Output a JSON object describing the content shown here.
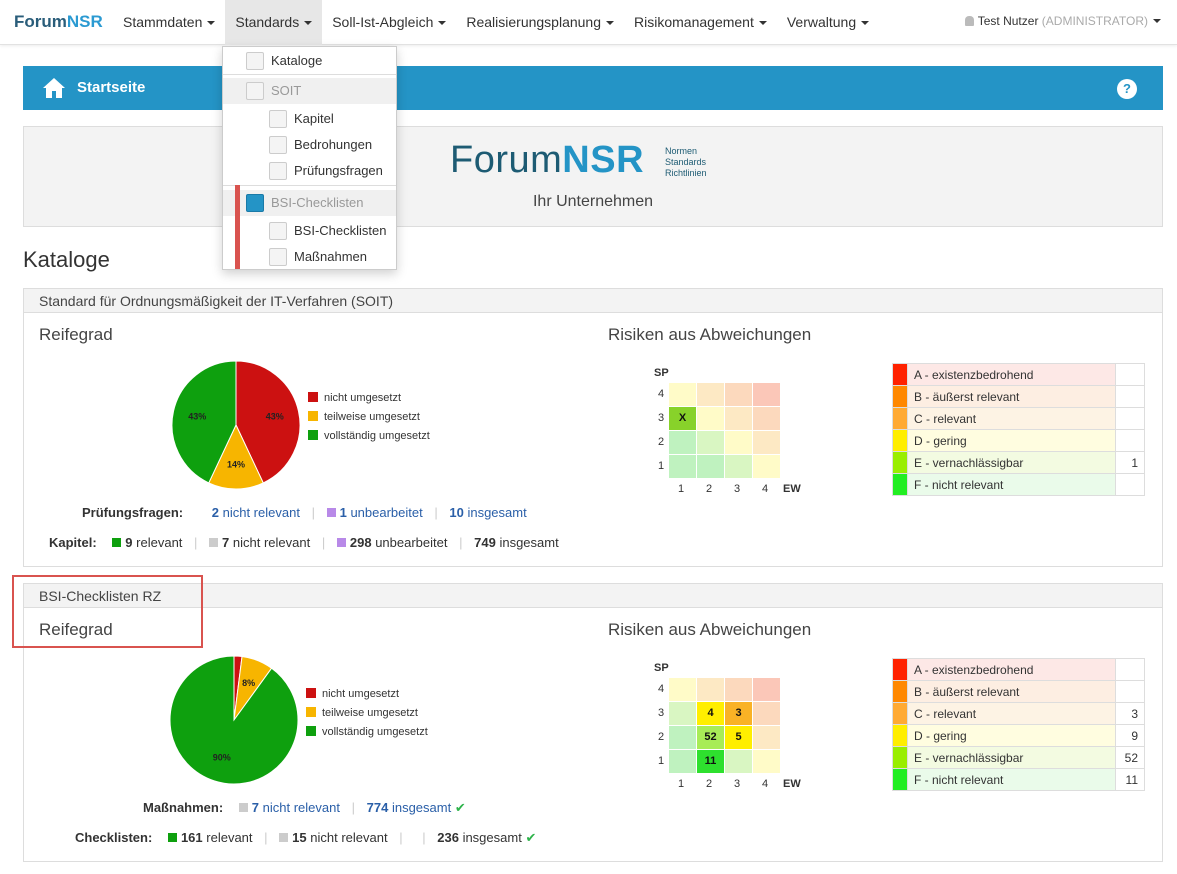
{
  "brand": {
    "part1": "Forum",
    "part2": "NSR"
  },
  "nav": {
    "items": [
      {
        "label": "Stammdaten",
        "active": false
      },
      {
        "label": "Standards",
        "active": true
      },
      {
        "label": "Soll-Ist-Abgleich",
        "active": false
      },
      {
        "label": "Realisierungsplanung",
        "active": false
      },
      {
        "label": "Risikomanagement",
        "active": false
      },
      {
        "label": "Verwaltung",
        "active": false
      }
    ],
    "user": {
      "name": "Test Nutzer",
      "role": "(ADMINISTRATOR)"
    }
  },
  "dropdown": {
    "kataloge": "Kataloge",
    "soit": "SOIT",
    "kapitel": "Kapitel",
    "bedrohungen": "Bedrohungen",
    "pruefungsfragen": "Prüfungsfragen",
    "bsi_head": "BSI-Checklisten",
    "bsi_checklisten": "BSI-Checklisten",
    "massnahmen": "Maßnahmen"
  },
  "bluebar": {
    "title": "Startseite",
    "help": "?"
  },
  "banner": {
    "logo1": "Forum",
    "logo2": "NSR",
    "tag1": "Normen",
    "tag2": "Standards",
    "tag3": "Richtlinien",
    "company": "Ihr Unternehmen"
  },
  "heading": "Kataloge",
  "colors": {
    "red": "#cc1111",
    "orange": "#f7b500",
    "green": "#0ea00e",
    "gray": "#cccccc",
    "purple": "#b889e8"
  },
  "panel1": {
    "title": "Standard für Ordnungsmäßigkeit der IT-Verfahren (SOIT)",
    "reifegrad": "Reifegrad",
    "risiken": "Risiken aus Abweichungen",
    "legend": [
      "nicht umgesetzt",
      "teilweise umgesetzt",
      "vollständig umgesetzt"
    ],
    "chart_data": {
      "type": "pie",
      "categories": [
        "nicht umgesetzt",
        "teilweise umgesetzt",
        "vollständig umgesetzt"
      ],
      "values": [
        43,
        14,
        43
      ],
      "labels": [
        "43%",
        "14%",
        "43%"
      ]
    },
    "stats1": {
      "label": "Prüfungsfragen:",
      "v1": "2",
      "t1": "nicht relevant",
      "v2": "1",
      "t2": "unbearbeitet",
      "v3": "10",
      "t3": "insgesamt"
    },
    "stats2": {
      "label": "Kapitel:",
      "v1": "9",
      "t1": "relevant",
      "v2": "7",
      "t2": "nicht relevant",
      "v3": "298",
      "t3": "unbearbeitet",
      "v4": "749",
      "t4": "insgesamt"
    },
    "matrix": {
      "cells": [
        [
          "",
          "",
          "",
          ""
        ],
        [
          "X",
          "",
          "",
          ""
        ],
        [
          "",
          "",
          "",
          ""
        ],
        [
          "",
          "",
          "",
          ""
        ]
      ]
    },
    "risks": [
      {
        "name": "A - existenzbedrohend",
        "count": ""
      },
      {
        "name": "B - äußerst relevant",
        "count": ""
      },
      {
        "name": "C - relevant",
        "count": ""
      },
      {
        "name": "D - gering",
        "count": ""
      },
      {
        "name": "E - vernachlässigbar",
        "count": "1"
      },
      {
        "name": "F - nicht relevant",
        "count": ""
      }
    ]
  },
  "panel2": {
    "title": "BSI-Checklisten RZ",
    "reifegrad": "Reifegrad",
    "risiken": "Risiken aus Abweichungen",
    "legend": [
      "nicht umgesetzt",
      "teilweise umgesetzt",
      "vollständig umgesetzt"
    ],
    "chart_data": {
      "type": "pie",
      "categories": [
        "nicht umgesetzt",
        "teilweise umgesetzt",
        "vollständig umgesetzt"
      ],
      "values": [
        2,
        8,
        90
      ],
      "labels": [
        "",
        "8%",
        "90%"
      ]
    },
    "stats1": {
      "label": "Maßnahmen:",
      "v1": "7",
      "t1": "nicht relevant",
      "v2": "774",
      "t2": "insgesamt"
    },
    "stats2": {
      "label": "Checklisten:",
      "v1": "161",
      "t1": "relevant",
      "v2": "15",
      "t2": "nicht relevant",
      "v3": "236",
      "t3": "insgesamt"
    },
    "matrix": {
      "cells": [
        [
          "",
          "",
          "",
          ""
        ],
        [
          "",
          "4",
          "3",
          ""
        ],
        [
          "",
          "52",
          "5",
          ""
        ],
        [
          "",
          "11",
          "",
          ""
        ]
      ]
    },
    "risks": [
      {
        "name": "A - existenzbedrohend",
        "count": ""
      },
      {
        "name": "B - äußerst relevant",
        "count": ""
      },
      {
        "name": "C - relevant",
        "count": "3"
      },
      {
        "name": "D - gering",
        "count": "9"
      },
      {
        "name": "E - vernachlässigbar",
        "count": "52"
      },
      {
        "name": "F - nicht relevant",
        "count": "11"
      }
    ]
  },
  "axis": {
    "sp": "SP",
    "ew": "EW",
    "rows": [
      "4",
      "3",
      "2",
      "1"
    ],
    "cols": [
      "1",
      "2",
      "3",
      "4"
    ]
  }
}
